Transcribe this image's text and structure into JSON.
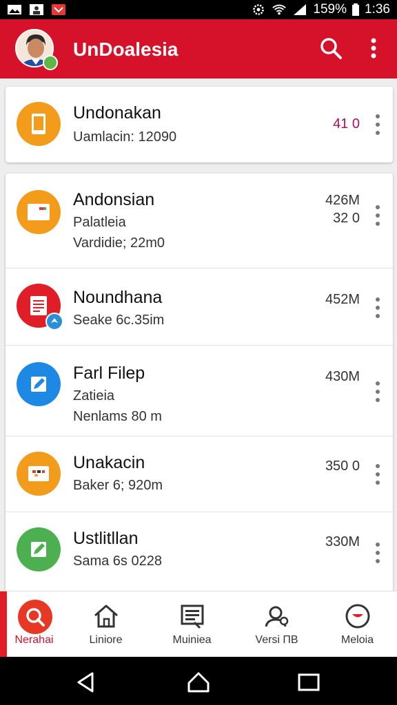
{
  "status": {
    "battery": "159%",
    "time": "1:36"
  },
  "app": {
    "title": "UnDoalesia"
  },
  "items": [
    {
      "title": "Undonakan",
      "line1": "Uamlacin: 12090",
      "line2": "",
      "size": "41 0",
      "size2": "",
      "color": "#f39c1c",
      "icon": "tablet-icon",
      "sizeColor": "#b0105e"
    },
    {
      "title": "Andonsian",
      "line1": "Palatleia",
      "line2": "Vardidie; 22m0",
      "size": "426M",
      "size2": "32 0",
      "color": "#f39c1c",
      "icon": "card-icon"
    },
    {
      "title": "Noundhana",
      "line1": "Seake 6c.35im",
      "line2": "",
      "size": "452M",
      "size2": "",
      "color": "#e01e28",
      "icon": "document-icon"
    },
    {
      "title": "Farl Filep",
      "line1": "Zatieia",
      "line2": "Nenlams 80 m",
      "size": "430M",
      "size2": "",
      "color": "#1e88e5",
      "icon": "edit-icon"
    },
    {
      "title": "Unakacin",
      "line1": "Baker 6; 920m",
      "line2": "",
      "size": "350 0",
      "size2": "",
      "color": "#f39c1c",
      "icon": "folder-icon"
    },
    {
      "title": "Ustlitllan",
      "line1": "Sama 6s 0228",
      "line2": "",
      "size": "330M",
      "size2": "",
      "color": "#4caf50",
      "icon": "edit-icon"
    }
  ],
  "nav": [
    {
      "label": "Nerahai",
      "icon": "search-icon"
    },
    {
      "label": "Liniore",
      "icon": "home-icon"
    },
    {
      "label": "Muiniea",
      "icon": "list-icon"
    },
    {
      "label": "Versi ПВ",
      "icon": "user-search-icon"
    },
    {
      "label": "Meloia",
      "icon": "chat-icon"
    }
  ]
}
